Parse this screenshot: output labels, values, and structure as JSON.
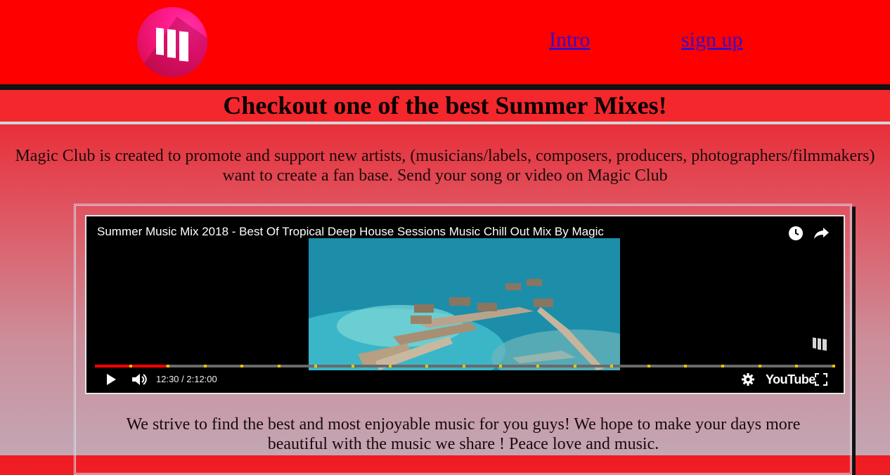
{
  "header": {
    "logo_name": "magic-club-logo",
    "nav": [
      {
        "label": "Intro"
      },
      {
        "label": "sign up"
      }
    ]
  },
  "headline": "Checkout one of the best Summer Mixes!",
  "intro_text": {
    "line1": "Magic Club is created to promote and support new artists, (musicians/labels, composers, producers, photographers/filmmakers)",
    "line2": "want to create a fan base. Send your song or video on Magic Club"
  },
  "video": {
    "title": "Summer Music Mix 2018 - Best Of Tropical Deep House Sessions Music Chill Out Mix By Magic",
    "time_display": "12:30 / 2:12:00",
    "progress": 0.096,
    "platform_label": "YouTube",
    "icons": [
      "watch-later-icon",
      "share-icon",
      "play-icon",
      "volume-icon",
      "settings-icon",
      "fullscreen-icon",
      "channel-watermark-icon"
    ]
  },
  "bottom_text": {
    "line1": "We strive to find the best and most enjoyable music for you guys! We hope to make your days more",
    "line2": "beautiful with the music we share ! Peace love and music."
  },
  "colors": {
    "header_bg": "#ff0000",
    "link": "#3a0ec2",
    "progress_played": "#ff0000",
    "chapter_marker": "#f2c200"
  }
}
